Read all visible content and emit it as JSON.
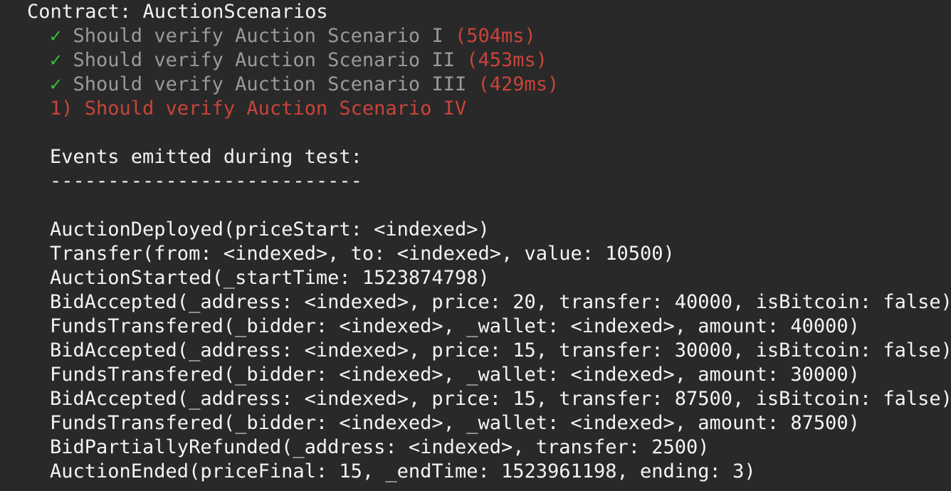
{
  "contract_title": "Contract: AuctionScenarios",
  "tests": [
    {
      "status": "passed",
      "mark": "✓",
      "name": "Should verify Auction Scenario I",
      "duration": "(504ms)"
    },
    {
      "status": "passed",
      "mark": "✓",
      "name": "Should verify Auction Scenario II",
      "duration": "(453ms)"
    },
    {
      "status": "passed",
      "mark": "✓",
      "name": "Should verify Auction Scenario III",
      "duration": "(429ms)"
    },
    {
      "status": "failed",
      "label": "1) Should verify Auction Scenario IV"
    }
  ],
  "events_header": "Events emitted during test:",
  "events_divider": "---------------------------",
  "events": [
    "AuctionDeployed(priceStart: <indexed>)",
    "Transfer(from: <indexed>, to: <indexed>, value: 10500)",
    "AuctionStarted(_startTime: 1523874798)",
    "BidAccepted(_address: <indexed>, price: 20, transfer: 40000, isBitcoin: false)",
    "FundsTransfered(_bidder: <indexed>, _wallet: <indexed>, amount: 40000)",
    "BidAccepted(_address: <indexed>, price: 15, transfer: 30000, isBitcoin: false)",
    "FundsTransfered(_bidder: <indexed>, _wallet: <indexed>, amount: 30000)",
    "BidAccepted(_address: <indexed>, price: 15, transfer: 87500, isBitcoin: false)",
    "FundsTransfered(_bidder: <indexed>, _wallet: <indexed>, amount: 87500)",
    "BidPartiallyRefunded(_address: <indexed>, transfer: 2500)",
    "AuctionEnded(priceFinal: 15, _endTime: 1523961198, ending: 3)"
  ],
  "colors": {
    "background": "#292929",
    "pass_mark": "#3dbf3d",
    "passed_text": "#9a9a9a",
    "failure": "#c9443a",
    "text": "#f2f2f2"
  }
}
